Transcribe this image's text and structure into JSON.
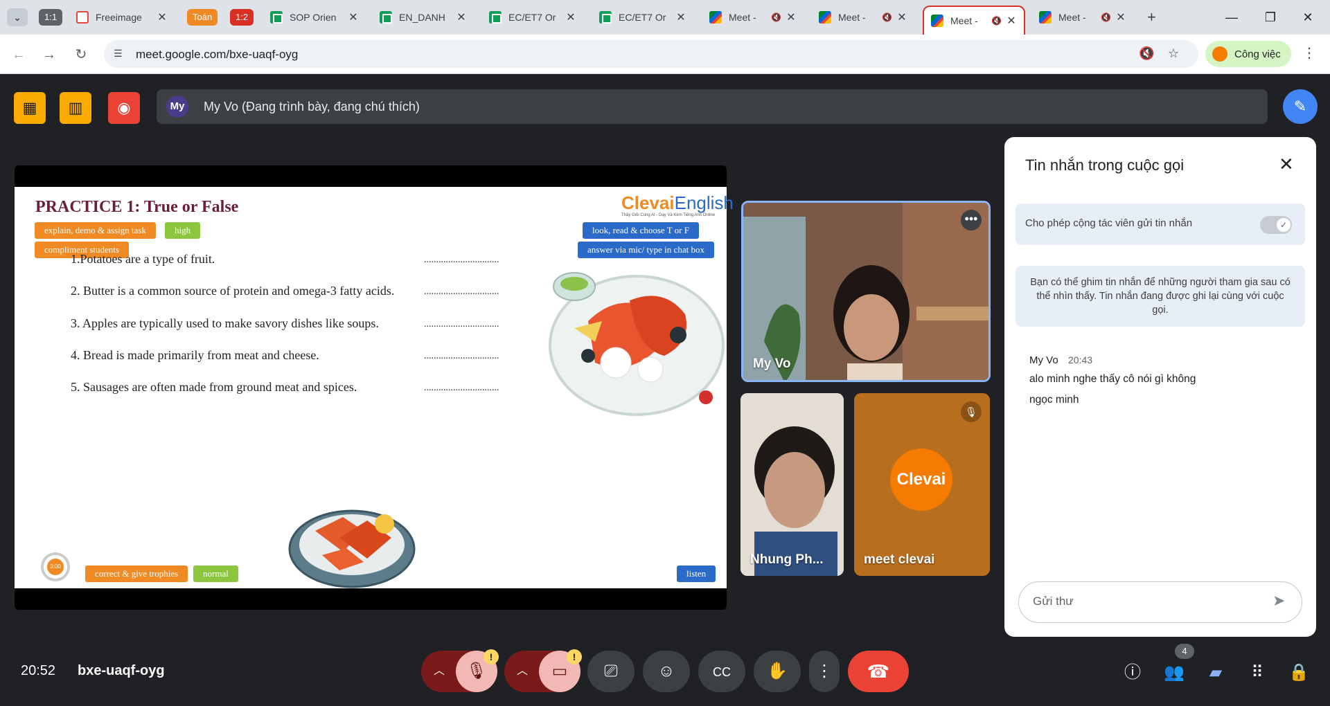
{
  "browser": {
    "tab_menu": "⌄",
    "chips": [
      {
        "label": "1:1",
        "color": "#5f6368"
      },
      {
        "label": "Toán",
        "color": "#f08a24"
      },
      {
        "label": "1:2",
        "color": "#d93025"
      }
    ],
    "tabs": [
      {
        "title": "Freeimage",
        "icon": "freeimage-icon"
      },
      {
        "title": "SOP Orien",
        "icon": "sheets-icon"
      },
      {
        "title": "EN_DANH",
        "icon": "sheets-icon"
      },
      {
        "title": "EC/ET7 Or",
        "icon": "sheets-icon"
      },
      {
        "title": "EC/ET7 Or",
        "icon": "sheets-icon"
      },
      {
        "title": "Meet -",
        "icon": "meet-icon"
      },
      {
        "title": "Meet -",
        "icon": "meet-icon"
      },
      {
        "title": "Meet -",
        "icon": "meet-icon"
      },
      {
        "title": "Meet -",
        "icon": "meet-icon"
      }
    ],
    "new_tab": "+",
    "url": "meet.google.com/bxe-uaqf-oyg",
    "profile_label": "Công việc"
  },
  "meet_top": {
    "presenter_avatar": "My",
    "presenter_text": "My Vo (Đang trình bày, đang chú thích)"
  },
  "slide": {
    "title": "PRACTICE 1: True or False",
    "tags_left": [
      "explain, demo & assign task",
      "high",
      "compliment students"
    ],
    "tags_right": [
      "look, read & choose T or F",
      "answer via mic/ type in chat box"
    ],
    "logo_main": "Clevai",
    "logo_en": "English",
    "logo_sub": "Thầy Giỏi Cùng AI - Dạy Và Kèm Tiếng Anh Online",
    "questions": [
      "1.Potatoes are a type of fruit.",
      "2. Butter is a common source of protein and omega-3 fatty acids.",
      "3. Apples are typically used to make savory dishes like soups.",
      "4. Bread is made primarily from meat and cheese.",
      "5. Sausages are often made from ground meat and spices."
    ],
    "answer_blank": "...............................",
    "timer": "3:00",
    "tags_bottom": [
      "correct & give trophies",
      "normal"
    ],
    "tag_listen": "listen"
  },
  "tiles": {
    "myvo_name": "My Vo",
    "nhung_name": "Nhung Ph...",
    "clevai_name": "meet clevai",
    "clevai_avatar": "Clevai"
  },
  "chat": {
    "title": "Tin nhắn trong cuộc gọi",
    "allow_label": "Cho phép cộng tác viên gửi tin nhắn",
    "allow_enabled": true,
    "info": "Bạn có thể ghim tin nhắn để những người tham gia sau có thể nhìn thấy. Tin nhắn đang được ghi lại cùng với cuộc gọi.",
    "message": {
      "author": "My Vo",
      "time": "20:43",
      "lines": [
        "alo minh nghe thấy cô nói gì không",
        "ngọc minh"
      ]
    },
    "input_placeholder": "Gửi thư"
  },
  "bottom": {
    "clock": "20:52",
    "meeting_code": "bxe-uaqf-oyg",
    "mic_warning": "!",
    "cam_warning": "!",
    "people_count": "4"
  }
}
